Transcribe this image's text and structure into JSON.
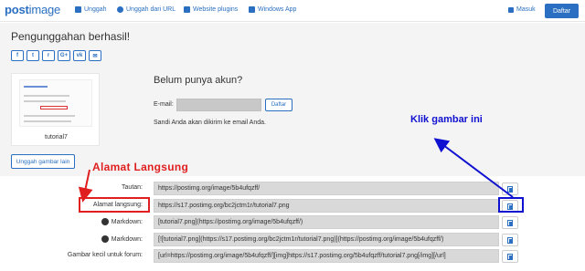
{
  "navbar": {
    "logo_bold": "post",
    "logo_thin": "image",
    "links": [
      {
        "label": "Unggah",
        "icon": "upload-icon"
      },
      {
        "label": "Unggah dari URL",
        "icon": "globe-icon"
      },
      {
        "label": "Website plugins",
        "icon": "puzzle-icon"
      },
      {
        "label": "Windows App",
        "icon": "windows-icon"
      }
    ],
    "login_label": "Masuk",
    "register_label": "Daftar"
  },
  "main": {
    "title": "Pengunggahan berhasil!",
    "share_buttons": [
      "f",
      "t",
      "r",
      "G+",
      "vk",
      "✉"
    ],
    "thumbnail_caption": "tutorial7",
    "upload_more_label": "Unggah gambar lain"
  },
  "account": {
    "title": "Belum punya akun?",
    "email_label": "E-mail:",
    "email_value": "",
    "register_button": "Daftar",
    "note": "Sandi Anda akan dikirim ke email Anda."
  },
  "annotations": {
    "right_text": "Klik gambar ini",
    "left_text": "Alamat Langsung",
    "color_red": "#e02020",
    "color_blue": "#1010d0"
  },
  "links": [
    {
      "label": "Tautan:",
      "icon": "",
      "value": "https://postimg.org/image/5b4ufqzff/"
    },
    {
      "label": "Alamat langsung:",
      "icon": "",
      "value": "https://s17.postimg.org/bc2jctm1r/tutorial7.png"
    },
    {
      "label": "Markdown:",
      "icon": "reddit-icon",
      "value": "[tutorial7.png](https://postimg.org/image/5b4ufqzff/)"
    },
    {
      "label": "Markdown:",
      "icon": "github-icon",
      "value": "[![tutorial7.png](https://s17.postimg.org/bc2jctm1r/tutorial7.png)](https://postimg.org/image/5b4ufqzff/)"
    },
    {
      "label": "Gambar kecil untuk forum:",
      "icon": "",
      "value": "[url=https://postimg.org/image/5b4ufqzff/][img]https://s17.postimg.org/5b4ufqzff/tutorial7.png[/img][/url]"
    }
  ],
  "colors": {
    "accent": "#2a6fc1",
    "content_bg": "#f4f4f4",
    "field_bg": "#d9d9d9"
  }
}
